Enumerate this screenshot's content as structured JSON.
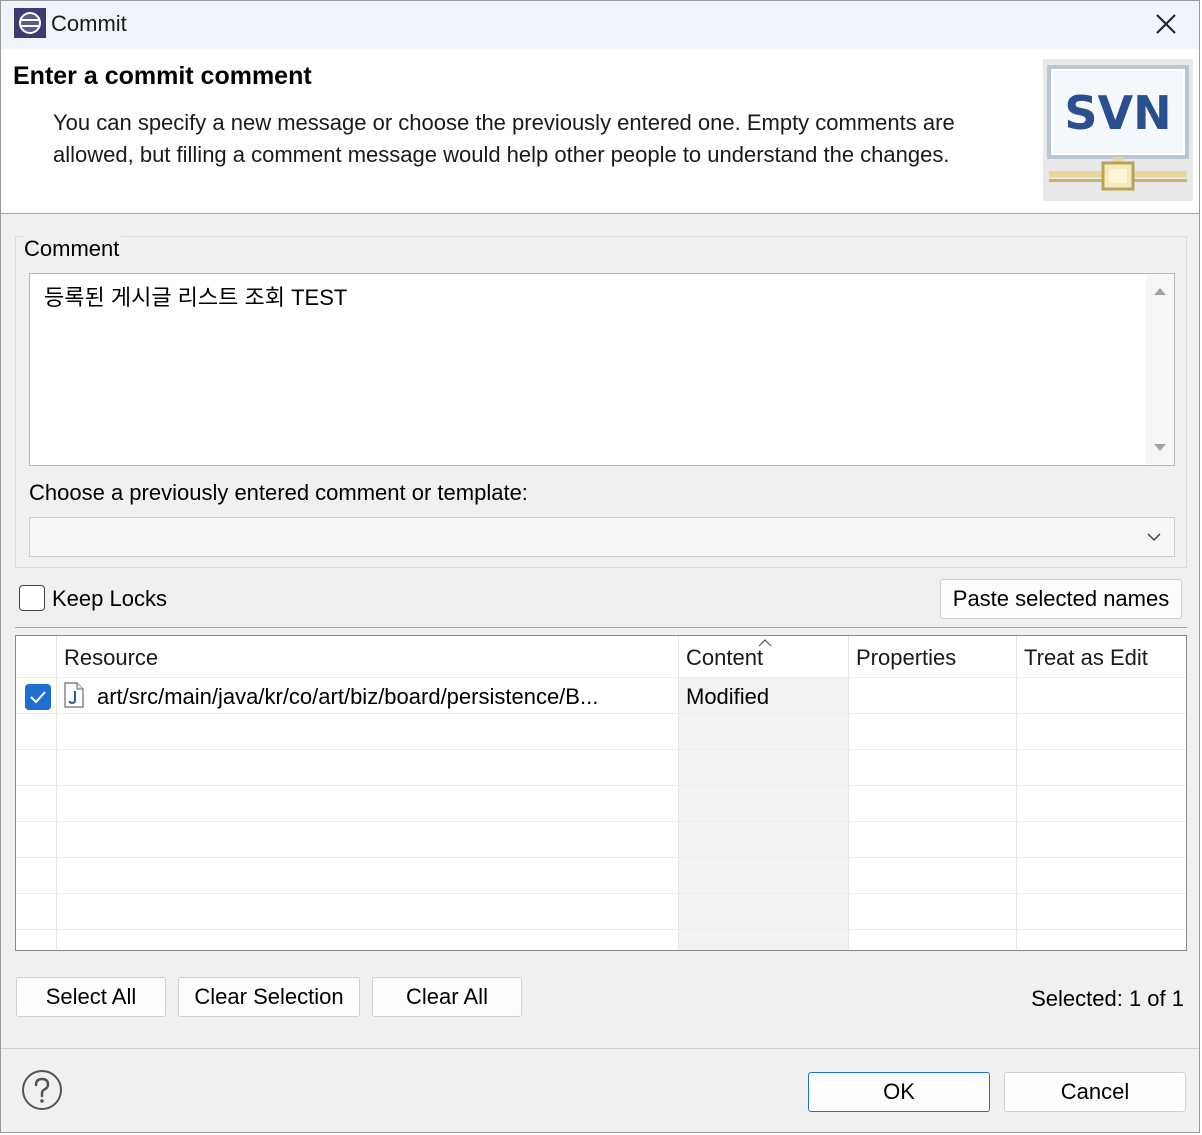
{
  "window": {
    "title": "Commit",
    "icons": {
      "app": "eclipse-icon",
      "close": "close-icon"
    }
  },
  "banner": {
    "title": "Enter a commit comment",
    "description": "You can specify a new message or choose the previously entered one. Empty comments are allowed, but filling a comment message would help other people to understand the changes.",
    "logo_text": "SVN"
  },
  "comment_group": {
    "label": "Comment",
    "comment_value": "등록된 게시글 리스트 조회 TEST",
    "choose_label": "Choose a previously entered comment or template:",
    "template_value": ""
  },
  "options": {
    "keep_locks_label": "Keep Locks",
    "keep_locks_checked": false,
    "paste_button": "Paste selected names"
  },
  "resources_table": {
    "columns": [
      "Resource",
      "Content",
      "Properties",
      "Treat as Edit"
    ],
    "sorted_column": "Content",
    "rows": [
      {
        "checked": true,
        "icon": "java-file-icon",
        "resource": "art/src/main/java/kr/co/art/biz/board/persistence/B...",
        "content": "Modified",
        "properties": "",
        "treat_as_edit": ""
      }
    ]
  },
  "selection": {
    "select_all": "Select All",
    "clear_selection": "Clear Selection",
    "clear_all": "Clear All",
    "status": "Selected: 1 of 1"
  },
  "footer": {
    "help_icon": "help-icon",
    "ok": "OK",
    "cancel": "Cancel"
  },
  "colors": {
    "accent": "#1e6fd0",
    "titlebar_bg": "#eff3fa",
    "dialog_bg": "#f0f0f0"
  }
}
